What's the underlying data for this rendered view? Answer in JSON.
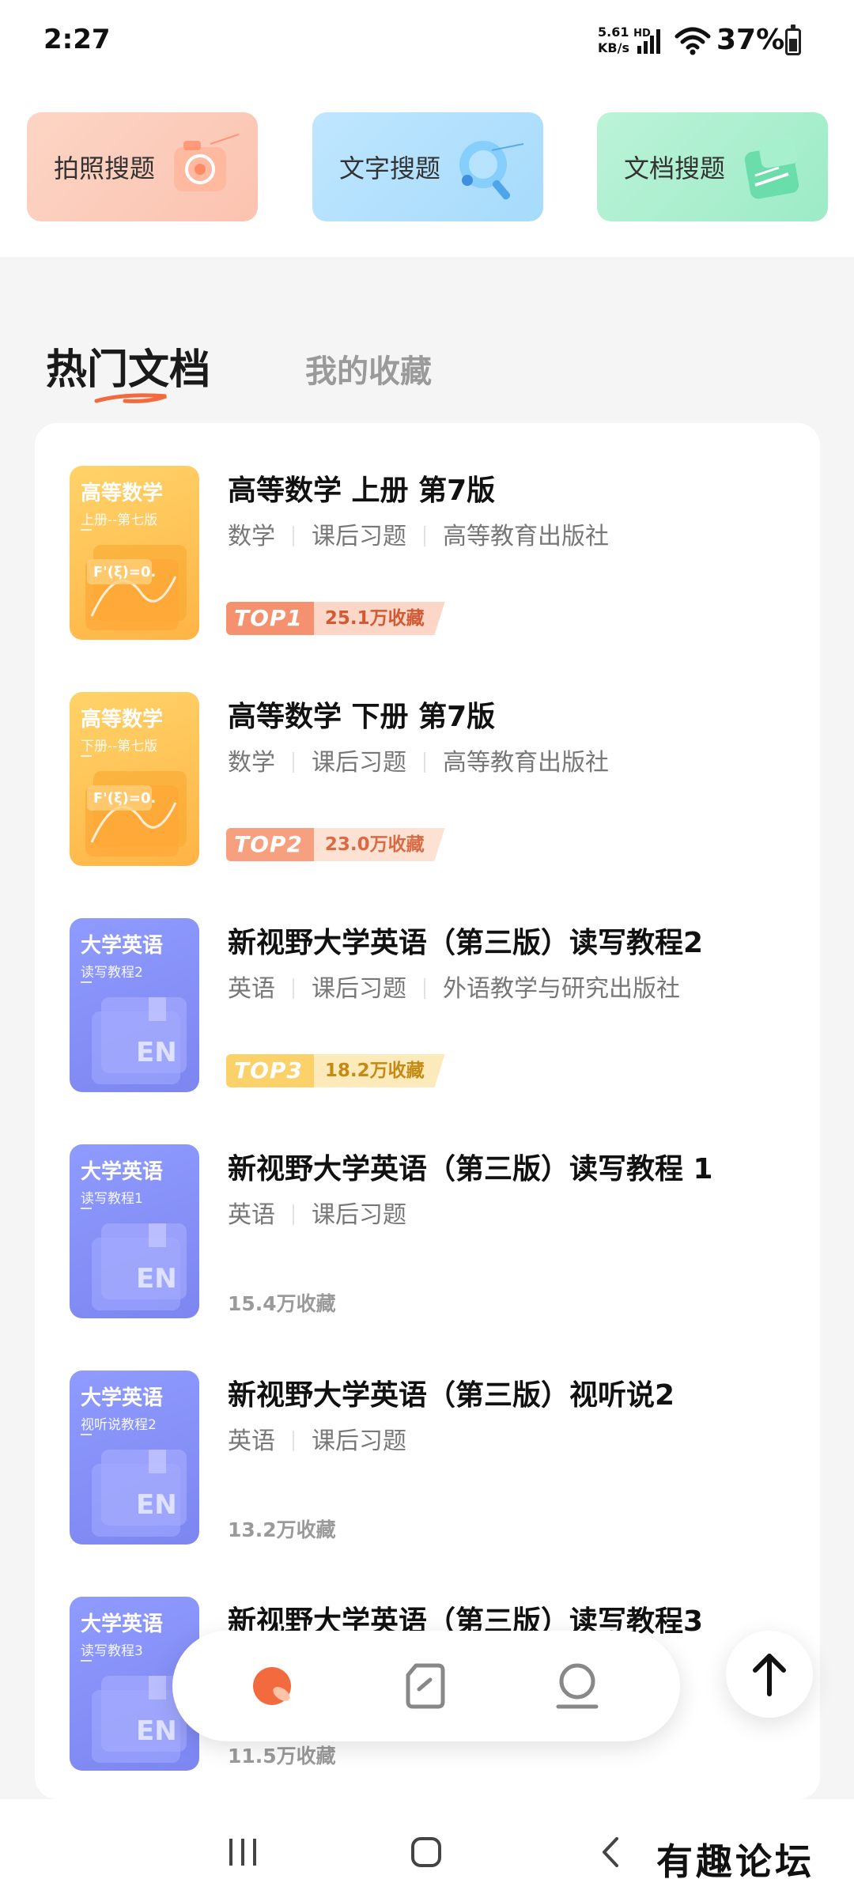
{
  "status_bar": {
    "time": "2:27",
    "net_speed_value": "5.61",
    "net_speed_unit": "KB/s",
    "hd": "HD",
    "battery": "37%"
  },
  "tools": [
    {
      "label": "拍照搜题",
      "icon": "camera-icon"
    },
    {
      "label": "文字搜题",
      "icon": "text-search-icon"
    },
    {
      "label": "文档搜题",
      "icon": "document-search-icon"
    }
  ],
  "tabs": {
    "hot": "热门文档",
    "favorites": "我的收藏"
  },
  "documents": [
    {
      "cover_title": "高等数学",
      "cover_sub": "上册--第七版",
      "title": "高等数学 上册 第7版",
      "subject": "数学",
      "type": "课后习题",
      "publisher": "高等教育出版社",
      "rank": "TOP1",
      "count": "25.1万收藏"
    },
    {
      "cover_title": "高等数学",
      "cover_sub": "下册--第七版",
      "title": "高等数学 下册 第7版",
      "subject": "数学",
      "type": "课后习题",
      "publisher": "高等教育出版社",
      "rank": "TOP2",
      "count": "23.0万收藏"
    },
    {
      "cover_title": "大学英语",
      "cover_sub": "读写教程2",
      "title": "新视野大学英语（第三版）读写教程2",
      "subject": "英语",
      "type": "课后习题",
      "publisher": "外语教学与研究出版社",
      "rank": "TOP3",
      "count": "18.2万收藏"
    },
    {
      "cover_title": "大学英语",
      "cover_sub": "读写教程1",
      "title": "新视野大学英语（第三版）读写教程 1",
      "subject": "英语",
      "type": "课后习题",
      "publisher": "",
      "rank": "",
      "count": "15.4万收藏"
    },
    {
      "cover_title": "大学英语",
      "cover_sub": "视听说教程2",
      "title": "新视野大学英语（第三版）视听说2",
      "subject": "英语",
      "type": "课后习题",
      "publisher": "",
      "rank": "",
      "count": "13.2万收藏"
    },
    {
      "cover_title": "大学英语",
      "cover_sub": "读写教程3",
      "title": "新视野大学英语（第三版）读写教程3",
      "subject": "",
      "type": "",
      "publisher": "",
      "rank": "",
      "count": "11.5万收藏"
    }
  ],
  "cover_glyphs": {
    "math": "F'(ξ)=0.",
    "english": "EN"
  },
  "watermark": "有趣论坛",
  "colors": {
    "accent": "#f26a3d",
    "math_cover": "#ffc257",
    "english_cover": "#8a93fb"
  }
}
